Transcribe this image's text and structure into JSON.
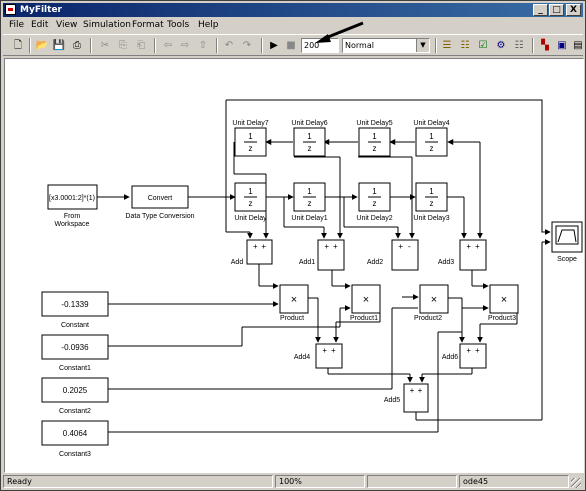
{
  "window": {
    "title": "MyFilter",
    "min_label": "_",
    "max_label": "□",
    "close_label": "X"
  },
  "menu": [
    "File",
    "Edit",
    "View",
    "Simulation",
    "Format",
    "Tools",
    "Help"
  ],
  "toolbar": {
    "stop_time": "200",
    "sim_mode": "Normal"
  },
  "diagram": {
    "from_workspace": {
      "value": "[x3.0001:2]*(1)",
      "name": "From\nWorkspace"
    },
    "convert": {
      "value": "Convert",
      "name": "Data Type Conversion"
    },
    "unit_delays_top": [
      "Unit Delay7",
      "Unit Delay6",
      "Unit Delay5",
      "Unit Delay4"
    ],
    "unit_delays_bottom": [
      "Unit Delay",
      "Unit Delay1",
      "Unit Delay2",
      "Unit Delay3"
    ],
    "delay_num": "1",
    "delay_den": "z",
    "adds_top": [
      "Add",
      "Add1",
      "Add2",
      "Add3"
    ],
    "products": [
      "Product",
      "Product1",
      "Product2",
      "Product3"
    ],
    "adds_bottom": [
      "Add4",
      "Add6",
      "Add5"
    ],
    "constants": [
      {
        "value": "-0.1339",
        "name": "Constant"
      },
      {
        "value": "-0.0936",
        "name": "Constant1"
      },
      {
        "value": "0.2025",
        "name": "Constant2"
      },
      {
        "value": "0.4064",
        "name": "Constant3"
      }
    ],
    "scope": "Scope",
    "plus": "+",
    "minus": "-",
    "times": "×"
  },
  "status": {
    "state": "Ready",
    "zoom": "100%",
    "solver": "ode45"
  }
}
